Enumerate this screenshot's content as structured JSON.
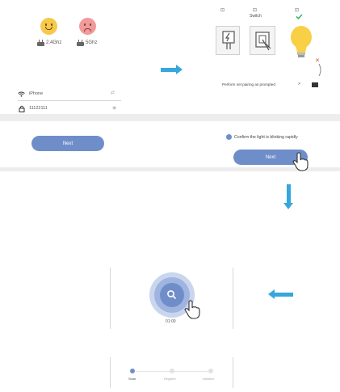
{
  "panel1": {
    "band_left": "2.4Ghz",
    "band_right": "5Ghz",
    "wifi_name": "iPhone",
    "password": "11122111",
    "next_label": "Next"
  },
  "panel2": {
    "top_labels": [
      "",
      "Switch",
      ""
    ],
    "instruction_link": "Perform net pairing as prompted",
    "link_chevron": ">",
    "confirm_text": "Confirm the light is blinking rapidly",
    "next_label": "Next"
  },
  "panel4": {
    "timer": "01:00",
    "steps": [
      "Scan",
      "Register",
      "Initialize"
    ]
  },
  "colors": {
    "accent": "#35a7dc",
    "button": "#6f8ec9"
  }
}
